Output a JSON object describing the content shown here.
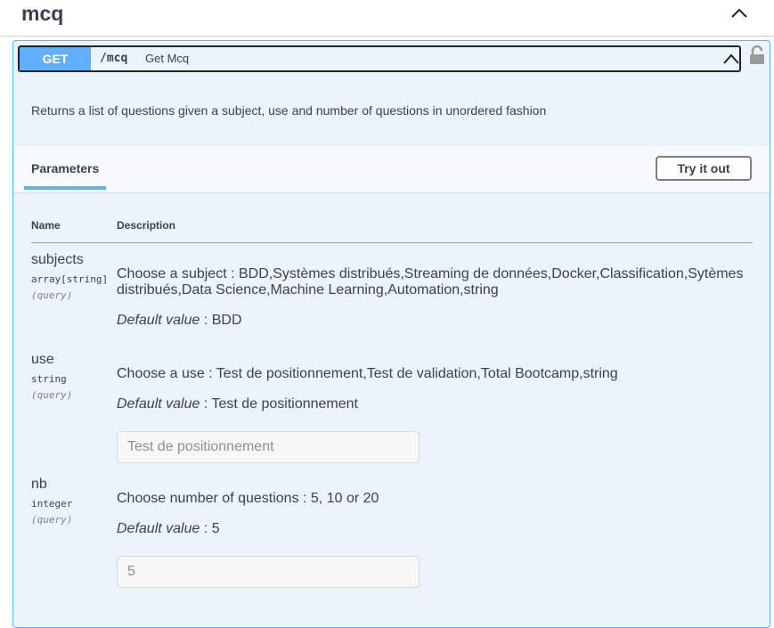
{
  "tag": {
    "title": "mcq"
  },
  "operation": {
    "method": "GET",
    "path": "/mcq",
    "summary": "Get Mcq",
    "description": "Returns a list of questions given a subject, use and number of questions in unordered fashion"
  },
  "params_section": {
    "tab_label": "Parameters",
    "try_button": "Try it out",
    "col_name": "Name",
    "col_description": "Description"
  },
  "params": [
    {
      "name": "subjects",
      "type": "array[string]",
      "in": "(query)",
      "description": "Choose a subject : BDD,Systèmes distribués,Streaming de données,Docker,Classification,Sytèmes distribués,Data Science,Machine Learning,Automation,string",
      "default_label": "Default value",
      "default_sep": " : ",
      "default_value": "BDD"
    },
    {
      "name": "use",
      "type": "string",
      "in": "(query)",
      "description": "Choose a use : Test de positionnement,Test de validation,Total Bootcamp,string",
      "default_label": "Default value",
      "default_sep": " : ",
      "default_value": "Test de positionnement",
      "input_placeholder": "Test de positionnement"
    },
    {
      "name": "nb",
      "type": "integer",
      "in": "(query)",
      "description": "Choose number of questions : 5, 10 or 20",
      "default_label": "Default value",
      "default_sep": " : ",
      "default_value": "5",
      "input_placeholder": "5"
    }
  ],
  "colors": {
    "get": "#61affe",
    "block_bg": "#ebf3fb",
    "text": "#3b4151"
  },
  "icons": {
    "collapse": "chevron-up-icon",
    "lock": "lock-icon"
  }
}
